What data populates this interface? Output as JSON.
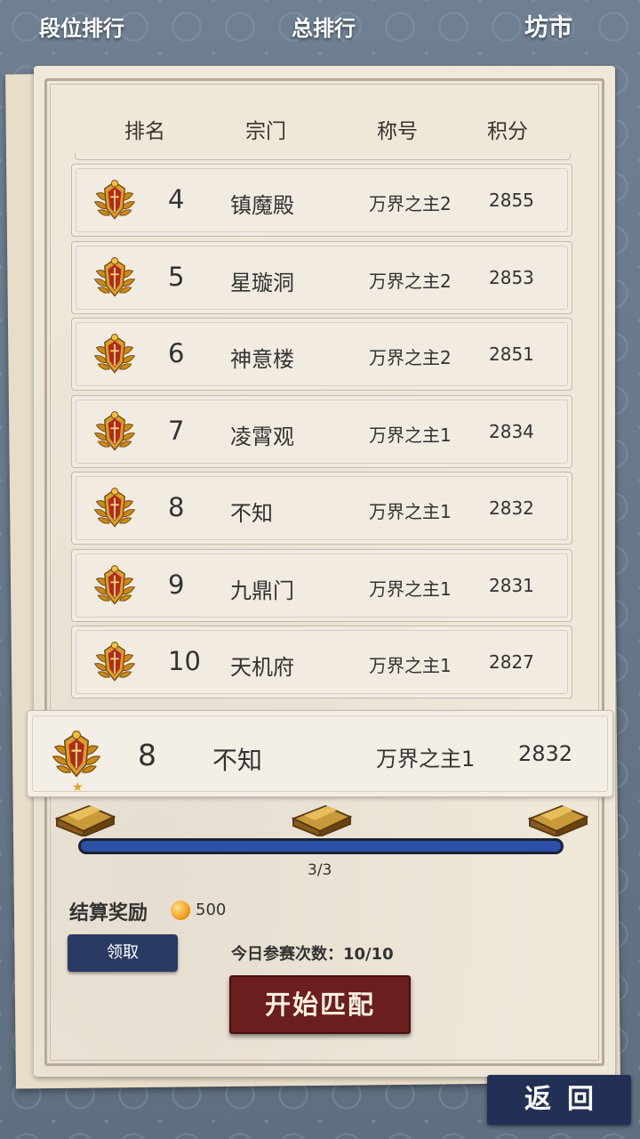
{
  "top_tabs": {
    "rank": "段位排行",
    "total": "总排行",
    "market": "坊市"
  },
  "headers": {
    "rank": "排名",
    "sect": "宗门",
    "title": "称号",
    "score": "积分"
  },
  "rows": [
    {
      "rank": "4",
      "sect": "镇魔殿",
      "title": "万界之主2",
      "score": "2855"
    },
    {
      "rank": "5",
      "sect": "星璇洞",
      "title": "万界之主2",
      "score": "2853"
    },
    {
      "rank": "6",
      "sect": "神意楼",
      "title": "万界之主2",
      "score": "2851"
    },
    {
      "rank": "7",
      "sect": "凌霄观",
      "title": "万界之主1",
      "score": "2834"
    },
    {
      "rank": "8",
      "sect": "不知",
      "title": "万界之主1",
      "score": "2832"
    },
    {
      "rank": "9",
      "sect": "九鼎门",
      "title": "万界之主1",
      "score": "2831"
    },
    {
      "rank": "10",
      "sect": "天机府",
      "title": "万界之主1",
      "score": "2827"
    }
  ],
  "my_row": {
    "rank": "8",
    "sect": "不知",
    "title": "万界之主1",
    "score": "2832",
    "star": "★"
  },
  "progress": {
    "text": "3/3",
    "fraction": 1.0
  },
  "reward": {
    "label": "结算奖励",
    "value": "500"
  },
  "claim_label": "领取",
  "count_text": "今日参赛次数：10/10",
  "match_label": "开始匹配",
  "back_label": "返回",
  "colors": {
    "accent_dark_blue": "#2a3a63",
    "match_red": "#6a1e1e",
    "progress_blue": "#2c4fa8"
  }
}
